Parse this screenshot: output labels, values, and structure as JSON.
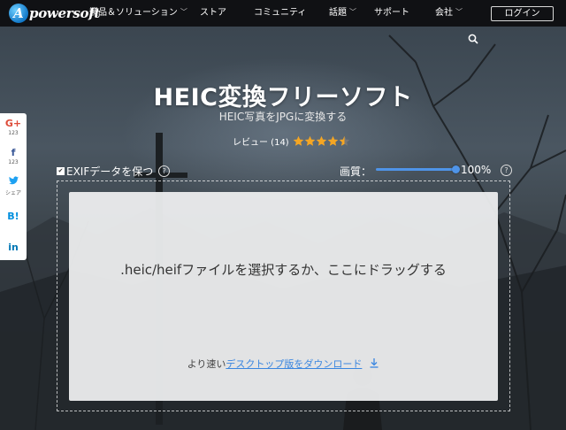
{
  "nav": {
    "logo_mark": "A",
    "logo_text": "powersoft",
    "items": [
      {
        "label": "製品＆ソリューション",
        "has_dropdown": true
      },
      {
        "label": "ストア",
        "has_dropdown": false
      },
      {
        "label": "コミュニティ",
        "has_dropdown": false
      },
      {
        "label": "話題",
        "has_dropdown": true
      },
      {
        "label": "サポート",
        "has_dropdown": false
      },
      {
        "label": "会社",
        "has_dropdown": true
      }
    ],
    "login_label": "ログイン"
  },
  "hero": {
    "title": "HEIC変換フリーソフト",
    "subtitle": "HEIC写真をJPGに変換する",
    "review_label": "レビュー (14)",
    "rating": 4.5,
    "rating_max": 5
  },
  "options": {
    "exif_label": "EXIFデータを保つ",
    "exif_checked": true,
    "quality_label": "画質：",
    "quality_value": "100%",
    "quality_fraction": 1.0
  },
  "dropzone": {
    "prompt": ".heic/heifファイルを選択するか、ここにドラッグする",
    "download_prefix": "より速い",
    "download_link": "デスクトップ版をダウンロード"
  },
  "share": {
    "items": [
      {
        "icon": "G+",
        "count": "123"
      },
      {
        "icon": "f",
        "count": "123"
      },
      {
        "icon": "🐦",
        "count": "シェア"
      },
      {
        "icon": "B!",
        "count": ""
      },
      {
        "icon": "in",
        "count": ""
      }
    ]
  },
  "colors": {
    "accent": "#4f94e8",
    "link": "#3a86e0",
    "star": "#f5a623",
    "nav_bg": "#101114"
  }
}
